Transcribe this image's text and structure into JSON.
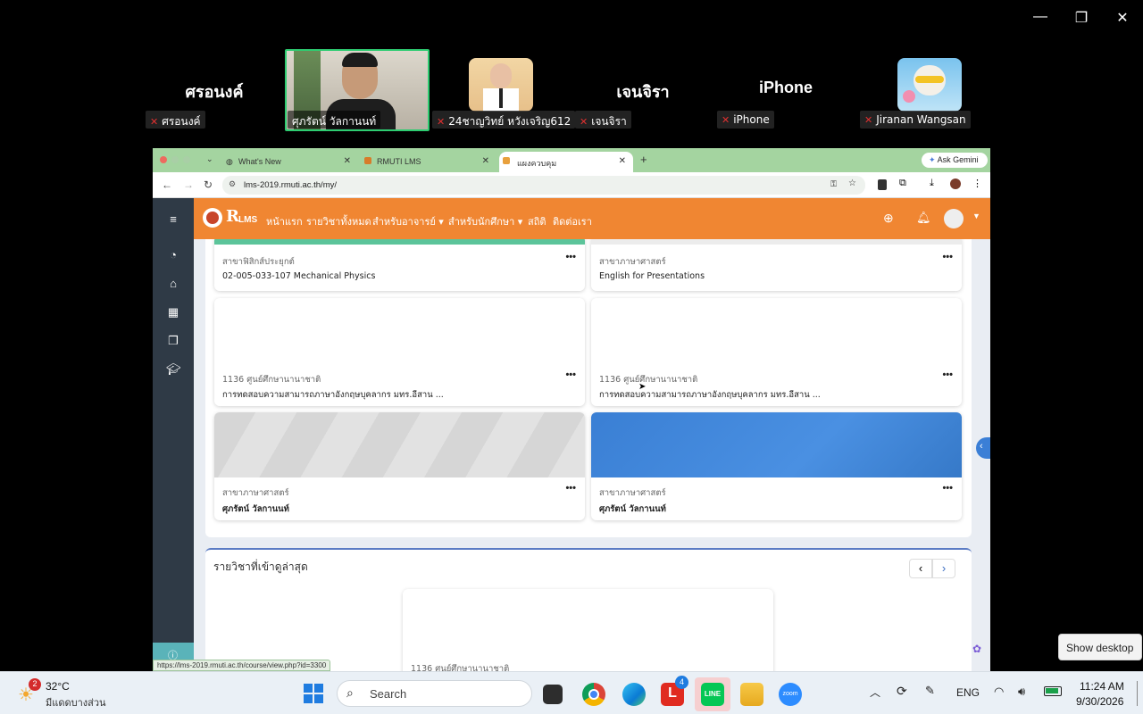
{
  "zoom": {
    "window_controls": [
      "—",
      "❐",
      "✕"
    ],
    "participants": [
      {
        "name": "ศรอนงค์",
        "label": "ศรอนงค์"
      },
      {
        "name": "",
        "label": "ศุภรัตน์ วัลกานนท์"
      },
      {
        "name": "",
        "label": "24ชาญวิทย์ หวังเจริญ612"
      },
      {
        "name": "เจนจิรา",
        "label": "เจนจิรา"
      },
      {
        "name": "iPhone",
        "label": "iPhone"
      },
      {
        "name": "",
        "label": "Jiranan Wangsan"
      }
    ]
  },
  "browser": {
    "tabs": [
      {
        "label": "What's New"
      },
      {
        "label": "RMUTI LMS"
      },
      {
        "label": "แผงควบคุม"
      }
    ],
    "ask_gemini": "Ask Gemini",
    "url": "lms-2019.rmuti.ac.th/my/",
    "status_url": "https://lms-2019.rmuti.ac.th/course/view.php?id=3300"
  },
  "lms": {
    "logo_text": "LMS",
    "nav": [
      "หน้าแรก",
      "รายวิชาทั้งหมด",
      "สำหรับอาจารย์ ▾",
      "สำหรับนักศึกษา ▾",
      "สถิติ",
      "ติดต่อเรา"
    ],
    "courses": [
      {
        "category": "สาขาฟิสิกส์ประยุกต์",
        "title": "02-005-033-107 Mechanical Physics"
      },
      {
        "category": "สาขาภาษาศาสตร์",
        "title": "English for Presentations"
      },
      {
        "category": "1136 ศูนย์ศึกษานานาชาติ",
        "title": "การทดสอบความสามารถภาษาอังกฤษบุคลากร มทร.อีสาน ..."
      },
      {
        "category": "1136 ศูนย์ศึกษานานาชาติ",
        "title": "การทดสอบความสามารถภาษาอังกฤษบุคลากร มทร.อีสาน ..."
      },
      {
        "category": "สาขาภาษาศาสตร์",
        "title": "ศุภรัตน์ วัลกานนท์"
      },
      {
        "category": "สาขาภาษาศาสตร์",
        "title": "ศุภรัตน์ วัลกานนท์"
      }
    ],
    "more": "•••",
    "recent_title": "รายวิชาที่เข้าดูล่าสุด",
    "recent_card_category": "1136 ศูนย์ศึกษานานาชาติ"
  },
  "tooltip": "Show desktop",
  "taskbar": {
    "weather_temp": "32°C",
    "weather_desc": "มีแดดบางส่วน",
    "weather_badge": "2",
    "search": "Search",
    "line_badge": "4",
    "lang": "ENG",
    "time": "11:24 AM",
    "date": "9/30/2026"
  }
}
